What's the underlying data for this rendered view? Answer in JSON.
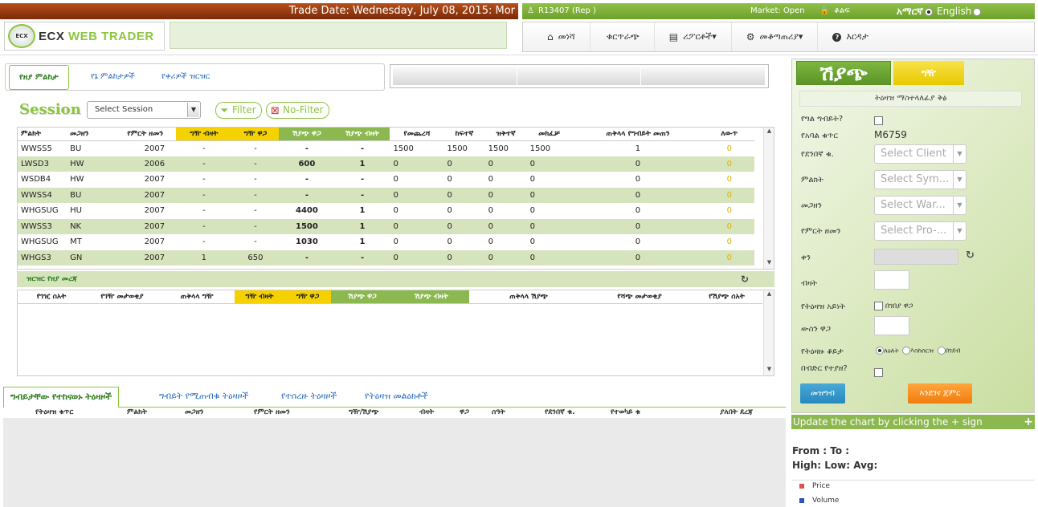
{
  "header": {
    "trade_date": "Trade Date: Wednesday, July 08, 2015: Mor",
    "logo_badge": "ECX",
    "logo_text_a": "ECX ",
    "logo_text_b": "WEB TRADER",
    "user": "R13407 (Rep )",
    "market_status": "Market: Open",
    "lock_label": "ቆልፍ",
    "lang_amharic": "አማርኛ",
    "lang_english": "English"
  },
  "nav": [
    {
      "icon": "home-icon",
      "glyph": "⌂",
      "label": "መነሻ"
    },
    {
      "icon": "",
      "glyph": "",
      "label": "ቁርጥራጭ"
    },
    {
      "icon": "file-icon",
      "glyph": "▤",
      "label": "ሪፖርቶች▾"
    },
    {
      "icon": "gear-icon",
      "glyph": "⚙",
      "label": "መቆጣጠሪያ▾"
    },
    {
      "icon": "help-icon",
      "glyph": "?",
      "label": "እርዳታ"
    }
  ],
  "market_tabs": [
    "የዘያ ምልከታ",
    "የኔ ምልከታዎች",
    "የቀሪዎች ዝርዝር"
  ],
  "session": {
    "label": "Session",
    "select_placeholder": "Select Session",
    "filter_label": "Filter",
    "nofilter_label": "No-Filter"
  },
  "market_table": {
    "columns": [
      "ምልክት",
      "መጋዘን",
      "የምርት ዘመን",
      "ግዥ ብዛት",
      "ግዥ ዋጋ",
      "ሽያጭ ዋጋ",
      "ሽያጭ ብዛት",
      "የመጨረሻ",
      "ከፍተኛ",
      "ዝቅተኛ",
      "መክፈቻ",
      "ጠቅላላ የግብይት መጠን",
      "ለውጥ"
    ],
    "rows": [
      [
        "WWSS5",
        "BU",
        "2007",
        "-",
        "-",
        "-",
        "-",
        "1500",
        "1500",
        "1500",
        "1500",
        "1",
        "0"
      ],
      [
        "LWSD3",
        "HW",
        "2006",
        "-",
        "-",
        "600",
        "1",
        "0",
        "0",
        "0",
        "0",
        "0",
        "0"
      ],
      [
        "WSDB4",
        "HW",
        "2007",
        "-",
        "-",
        "-",
        "-",
        "0",
        "0",
        "0",
        "0",
        "0",
        "0"
      ],
      [
        "WWSS4",
        "BU",
        "2007",
        "-",
        "-",
        "-",
        "-",
        "0",
        "0",
        "0",
        "0",
        "0",
        "0"
      ],
      [
        "WHGSUG",
        "HU",
        "2007",
        "-",
        "-",
        "4400",
        "1",
        "0",
        "0",
        "0",
        "0",
        "0",
        "0"
      ],
      [
        "WWSS3",
        "NK",
        "2007",
        "-",
        "-",
        "1500",
        "1",
        "0",
        "0",
        "0",
        "0",
        "0",
        "0"
      ],
      [
        "WHGSUG",
        "MT",
        "2007",
        "-",
        "-",
        "1030",
        "1",
        "0",
        "0",
        "0",
        "0",
        "0",
        "0"
      ],
      [
        "WHGS3",
        "GN",
        "2007",
        "1",
        "650",
        "-",
        "-",
        "0",
        "0",
        "0",
        "0",
        "0",
        "0"
      ]
    ]
  },
  "detail": {
    "title": "ዝርዝር የዘያ መረጃ",
    "columns": [
      "የገዢ ሰአት",
      "የገዥ መታወቂያ",
      "ጠቅላላ ግዥ",
      "ግዥ ብዛት",
      "ግዥ ዋጋ",
      "ሽያጭ ዋጋ",
      "ሽያጭ ብዛት",
      "ጠቅላላ ሽያጭ",
      "የሻጭ መታወቂያ",
      "የሽያጭ ሰአት"
    ]
  },
  "order_tabs": [
    "ግብይታቸው የተከናወኑ ትዕዛዞች",
    "ግብይት የሚጠብቁ ትዕዛዞች",
    "የተሰረዙ ትዕዛዞች",
    "የትዕዛዝ መልዕክቶች"
  ],
  "order_columns": [
    "የትዕዛዝ ቁጥር",
    "ምልክት",
    "መጋዘን",
    "የምርት ዘመን",
    "ግዥ/ሽያጭ",
    "ብዛት",
    "ዋጋ",
    "ሰዓት",
    "የደንበኛ ቁ.",
    "የተወካይ ቁ",
    "ያለበት ደረጃ"
  ],
  "order_form": {
    "buy_tab": "ሽያጭ",
    "sell_tab": "ግዥ",
    "title": "ትዕዛዝ ማስተላለፊያ ቅፅ",
    "labels": {
      "own_trade": "የግል ግብይት?",
      "member_no": "የአባል ቁጥር",
      "client": "የደንበኛ ቁ.",
      "symbol": "ምልክት",
      "warehouse": "መጋዘን",
      "prod_year": "የምርት ዘመን",
      "date": "ቀን",
      "quantity": "ብዛት",
      "order_type": "የትዕዛዝ አይነት",
      "limit_price": "ውስን ዋጋ",
      "validity": "የትዕዛዙ ቆይታ",
      "bidder": "በብድር የተያዘ?"
    },
    "member_no_value": "M6759",
    "client_placeholder": "Select Client",
    "symbol_placeholder": "Select Sym...",
    "warehouse_placeholder": "Select War...",
    "prod_placeholder": "Select Pro-...",
    "market_price_label": "በገበያ ዋጋ",
    "validity_options": [
      "ለዕለት",
      "እስከሰርዝ",
      "በገደብ"
    ],
    "cancel_btn": "መዝግብ",
    "submit_btn": "እንደገና ጀምር"
  },
  "chart": {
    "bar_text": "Update the chart by clicking the + sign",
    "plus": "+",
    "range_text": "From :    To :",
    "stats_text": "High: Low: Avg:",
    "legend": [
      {
        "label": "Price",
        "color": "#e05050"
      },
      {
        "label": "Volume",
        "color": "#3050c0"
      }
    ]
  }
}
